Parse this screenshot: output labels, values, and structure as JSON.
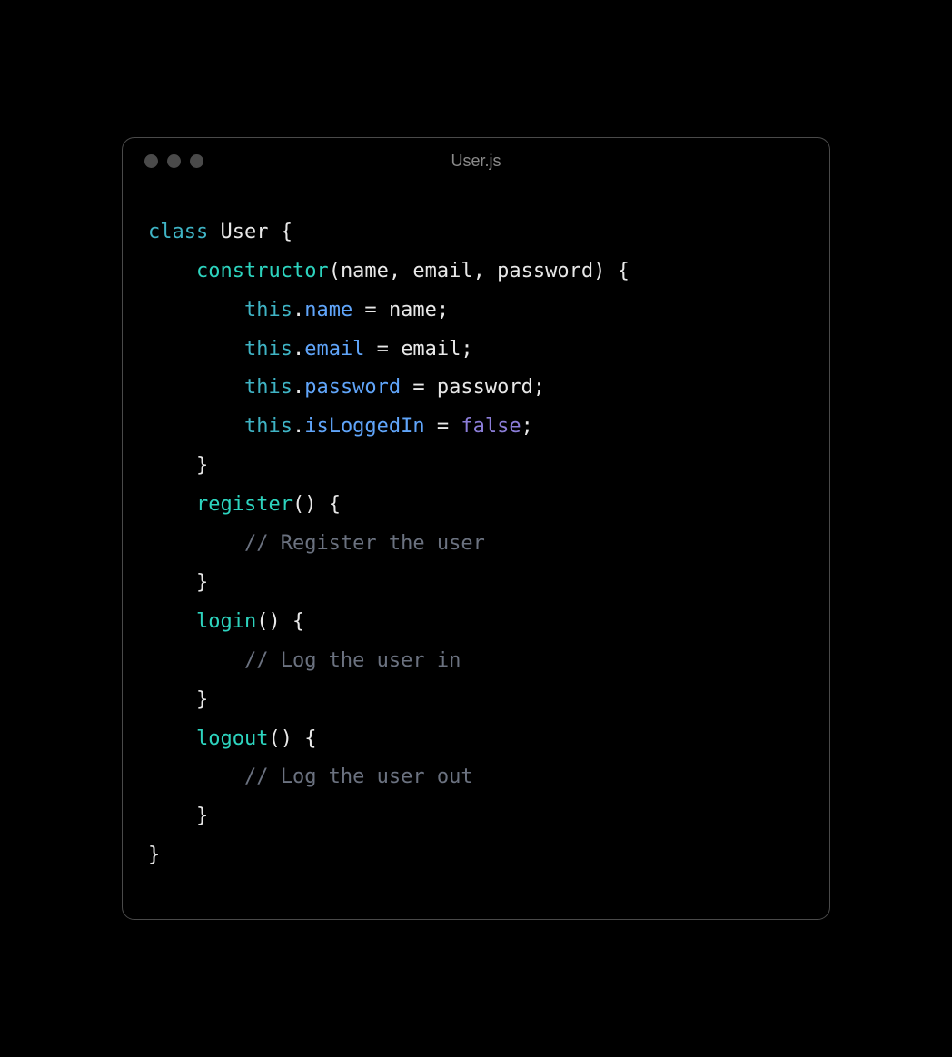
{
  "window": {
    "title": "User.js"
  },
  "code": {
    "indent1": "    ",
    "indent2": "        ",
    "tokens": {
      "class_kw": "class",
      "class_name": "User",
      "open_brace": " {",
      "constructor": "constructor",
      "paren_open": "(",
      "param_name": "name",
      "comma_sp": ", ",
      "param_email": "email",
      "param_password": "password",
      "paren_close": ")",
      "brace_open_sp": " {",
      "this": "this",
      "dot": ".",
      "prop_name": "name",
      "assign": " = ",
      "var_name": "name",
      "semi": ";",
      "prop_email": "email",
      "var_email": "email",
      "prop_password": "password",
      "var_password": "password",
      "prop_isLoggedIn": "isLoggedIn",
      "false_kw": "false",
      "close_brace": "}",
      "method_register": "register",
      "parens_empty": "()",
      "comment_register": "// Register the user",
      "method_login": "login",
      "comment_login": "// Log the user in",
      "method_logout": "logout",
      "comment_logout": "// Log the user out"
    }
  }
}
